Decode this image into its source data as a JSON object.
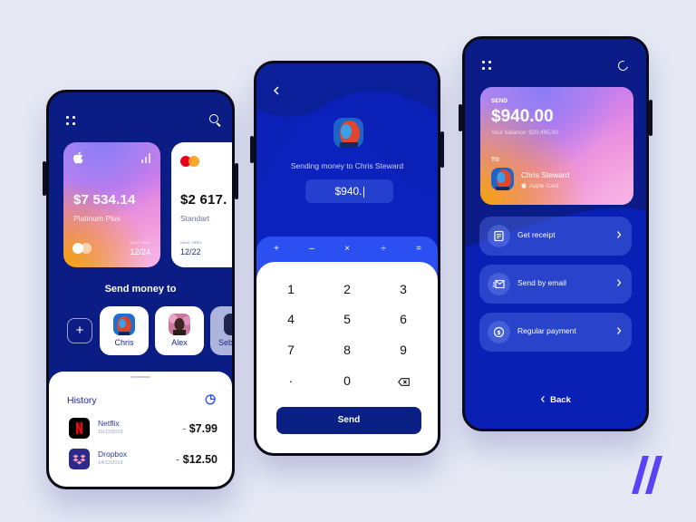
{
  "colors": {
    "background": "#e6e8f4",
    "phone_blue": "#0b1c84",
    "bright_blue": "#2b4ff0",
    "send_button": "#0a2085",
    "brand_accent": "#5b43f5"
  },
  "wallet_screen": {
    "icons": {
      "menu": "dots-grid-icon",
      "search": "search-icon"
    },
    "cards": [
      {
        "brand_icon": "apple-icon",
        "status_icon": "signal-bars-icon",
        "amount": "$7 534.14",
        "type": "Platinum Plus",
        "network_icon": "mastercard-icon",
        "valid_label": "VALID THRU",
        "valid_thru": "12/24"
      },
      {
        "network_icon": "mastercard-icon",
        "amount": "$2 617.",
        "type": "Standart",
        "valid_label": "VALID THRU",
        "valid_thru": "12/22"
      }
    ],
    "send_money_title": "Send money to",
    "add_contact_label": "+",
    "contacts": [
      {
        "name": "Chris"
      },
      {
        "name": "Alex"
      },
      {
        "name": "Seb"
      }
    ],
    "history": {
      "title": "History",
      "icon": "pie-chart-icon",
      "transactions": [
        {
          "name": "Netflix",
          "date": "15/12/2019",
          "sign": "- ",
          "amount": "$7.99",
          "logo": "netflix-logo-icon"
        },
        {
          "name": "Dropbox",
          "date": "14/12/2019",
          "sign": "- ",
          "amount": "$12.50",
          "logo": "dropbox-logo-icon"
        }
      ]
    }
  },
  "send_screen": {
    "back_icon": "chevron-left-icon",
    "sending_text": "Sending money to Chris Steward",
    "amount_value": "$940.",
    "operators": [
      "+",
      "–",
      "×",
      "÷",
      "="
    ],
    "keys": [
      "1",
      "2",
      "3",
      "4",
      "5",
      "6",
      "7",
      "8",
      "9",
      "·",
      "0"
    ],
    "backspace_icon": "backspace-icon",
    "send_label": "Send"
  },
  "confirm_screen": {
    "icons": {
      "menu": "dots-grid-icon",
      "refresh": "refresh-icon"
    },
    "send_label": "SEND",
    "amount": "$940.00",
    "balance": "Your balance: $20,495.00",
    "to_label": "TO",
    "recipient_name": "Chris Steward",
    "recipient_card": "Apple Card",
    "actions": [
      {
        "label": "Get receipt",
        "icon": "receipt-icon"
      },
      {
        "label": "Send by email",
        "icon": "email-icon"
      },
      {
        "label": "Regular payment",
        "icon": "recurring-payment-icon"
      }
    ],
    "back_label": "Back"
  }
}
